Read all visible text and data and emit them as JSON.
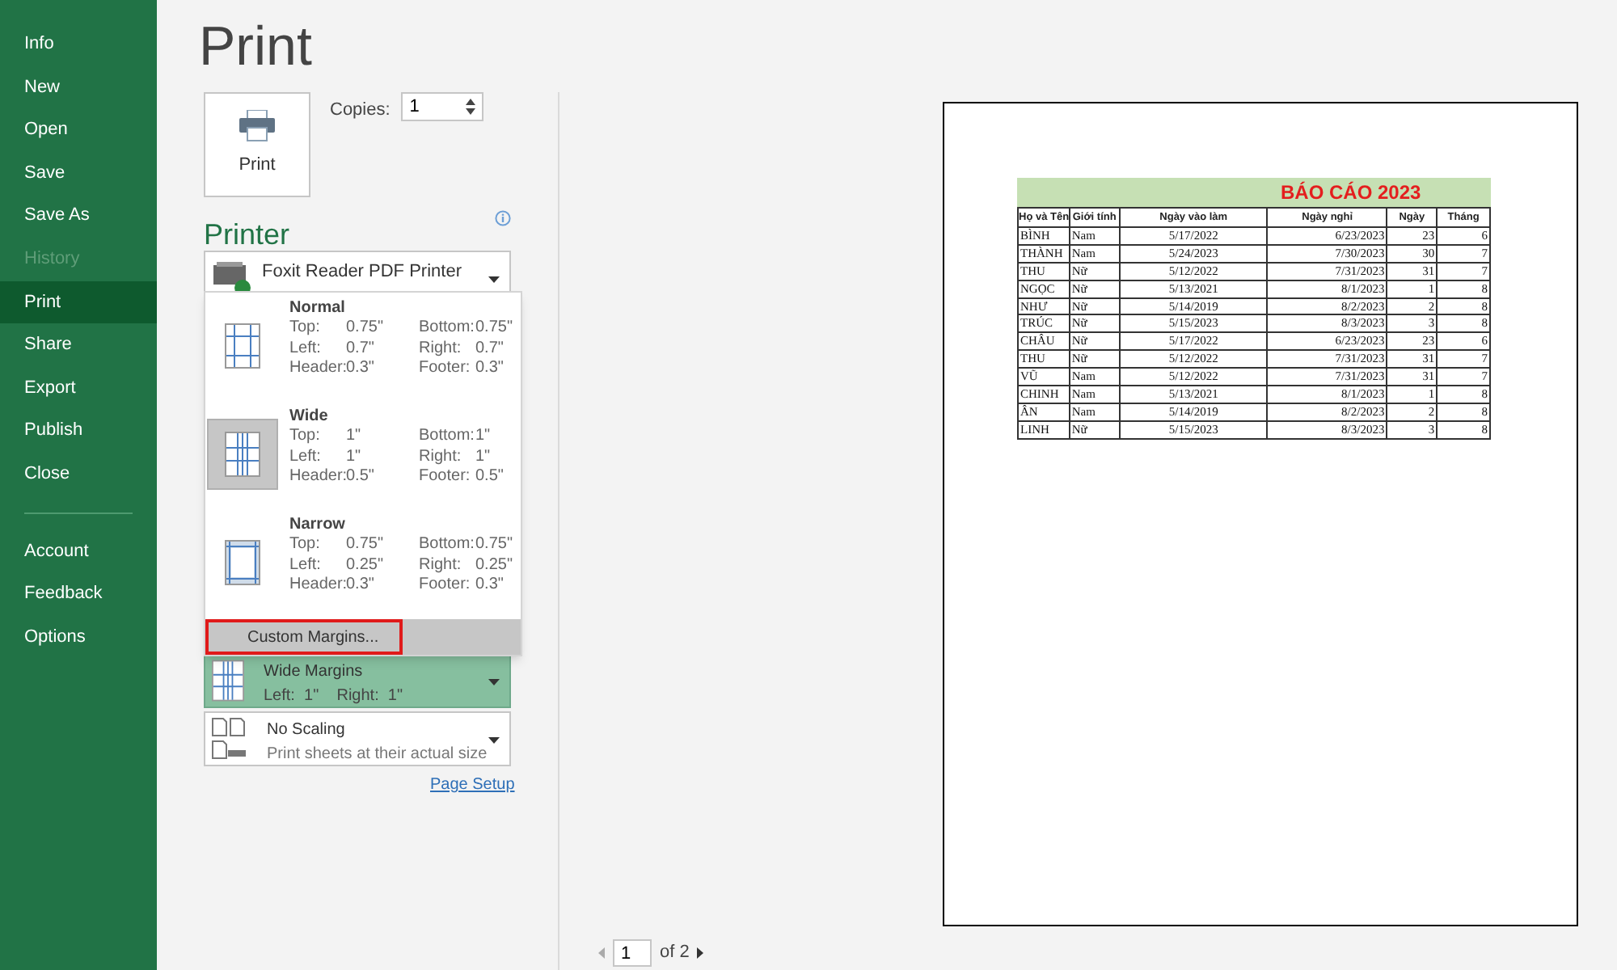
{
  "sidebar": {
    "items": [
      {
        "label": "Info",
        "selected": false,
        "disabled": false
      },
      {
        "label": "New",
        "selected": false,
        "disabled": false
      },
      {
        "label": "Open",
        "selected": false,
        "disabled": false
      },
      {
        "label": "Save",
        "selected": false,
        "disabled": false
      },
      {
        "label": "Save As",
        "selected": false,
        "disabled": false
      },
      {
        "label": "History",
        "selected": false,
        "disabled": true
      },
      {
        "label": "Print",
        "selected": true,
        "disabled": false
      },
      {
        "label": "Share",
        "selected": false,
        "disabled": false
      },
      {
        "label": "Export",
        "selected": false,
        "disabled": false
      },
      {
        "label": "Publish",
        "selected": false,
        "disabled": false
      },
      {
        "label": "Close",
        "selected": false,
        "disabled": false
      }
    ],
    "bottom_items": [
      {
        "label": "Account",
        "selected": false,
        "disabled": false
      },
      {
        "label": "Feedback",
        "selected": false,
        "disabled": false
      },
      {
        "label": "Options",
        "selected": false,
        "disabled": false
      }
    ]
  },
  "title": "Print",
  "print_button": "Print",
  "copies": {
    "label": "Copies:",
    "value": "1"
  },
  "printer": {
    "heading": "Printer",
    "name": "Foxit Reader PDF Printer"
  },
  "margins_menu": {
    "items": [
      {
        "name": "Normal",
        "kind": "normal",
        "selected": false,
        "fields": [
          {
            "label": "Top:",
            "value": "0.75\""
          },
          {
            "label": "Bottom:",
            "value": "0.75\""
          },
          {
            "label": "Left:",
            "value": "0.7\""
          },
          {
            "label": "Right:",
            "value": "0.7\""
          },
          {
            "label": "Header:",
            "value": "0.3\""
          },
          {
            "label": "Footer:",
            "value": "0.3\""
          }
        ]
      },
      {
        "name": "Wide",
        "kind": "wide",
        "selected": true,
        "fields": [
          {
            "label": "Top:",
            "value": "1\""
          },
          {
            "label": "Bottom:",
            "value": "1\""
          },
          {
            "label": "Left:",
            "value": "1\""
          },
          {
            "label": "Right:",
            "value": "1\""
          },
          {
            "label": "Header:",
            "value": "0.5\""
          },
          {
            "label": "Footer:",
            "value": "0.5\""
          }
        ]
      },
      {
        "name": "Narrow",
        "kind": "narrow",
        "selected": false,
        "fields": [
          {
            "label": "Top:",
            "value": "0.75\""
          },
          {
            "label": "Bottom:",
            "value": "0.75\""
          },
          {
            "label": "Left:",
            "value": "0.25\""
          },
          {
            "label": "Right:",
            "value": "0.25\""
          },
          {
            "label": "Header:",
            "value": "0.3\""
          },
          {
            "label": "Footer:",
            "value": "0.3\""
          }
        ]
      }
    ],
    "custom": {
      "label": "Custom Margins...",
      "highlighted": true
    }
  },
  "settings": [
    {
      "kind": "margins",
      "title": "Wide Margins",
      "subtitle": "Left:  1\"    Right:  1\"",
      "selected": true
    },
    {
      "kind": "scaling",
      "title": "No Scaling",
      "subtitle": "Print sheets at their actual size",
      "selected": false
    }
  ],
  "page_setup": "Page Setup",
  "preview": {
    "title": "BÁO CÁO 2023",
    "columns": [
      "Họ và Tên",
      "Giới tính",
      "Ngày vào làm",
      "Ngày nghỉ",
      "Ngày",
      "Tháng"
    ],
    "rows": [
      [
        "BÌNH",
        "Nam",
        "5/17/2022",
        "6/23/2023",
        "23",
        "6"
      ],
      [
        "THÀNH",
        "Nam",
        "5/24/2023",
        "7/30/2023",
        "30",
        "7"
      ],
      [
        "THU",
        "Nữ",
        "5/12/2022",
        "7/31/2023",
        "31",
        "7"
      ],
      [
        "NGỌC",
        "Nữ",
        "5/13/2021",
        "8/1/2023",
        "1",
        "8"
      ],
      [
        "NHƯ",
        "Nữ",
        "5/14/2019",
        "8/2/2023",
        "2",
        "8"
      ],
      [
        "TRÚC",
        "Nữ",
        "5/15/2023",
        "8/3/2023",
        "3",
        "8"
      ],
      [
        "CHÂU",
        "Nữ",
        "5/17/2022",
        "6/23/2023",
        "23",
        "6"
      ],
      [
        "THU",
        "Nữ",
        "5/12/2022",
        "7/31/2023",
        "31",
        "7"
      ],
      [
        "VŨ",
        "Nam",
        "5/12/2022",
        "7/31/2023",
        "31",
        "7"
      ],
      [
        "CHINH",
        "Nam",
        "5/13/2021",
        "8/1/2023",
        "1",
        "8"
      ],
      [
        "ÂN",
        "Nam",
        "5/14/2019",
        "8/2/2023",
        "2",
        "8"
      ],
      [
        "LINH",
        "Nữ",
        "5/15/2023",
        "8/3/2023",
        "3",
        "8"
      ]
    ]
  },
  "page_nav": {
    "page": "1",
    "of": "of 2"
  }
}
